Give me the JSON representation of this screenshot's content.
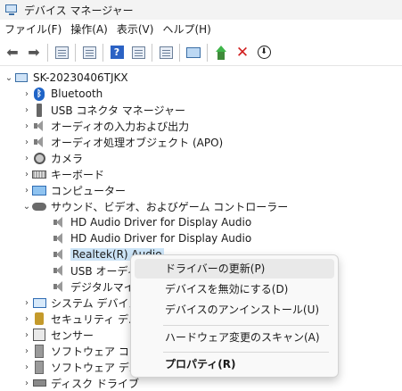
{
  "window": {
    "title": "デバイス マネージャー"
  },
  "menu": [
    "ファイル(F)",
    "操作(A)",
    "表示(V)",
    "ヘルプ(H)"
  ],
  "toolbar": {
    "back_icon": "back-arrow",
    "forward_icon": "forward-arrow",
    "help_glyph": "?",
    "remove_glyph": "✕",
    "update_glyph": "⬇"
  },
  "tree": {
    "root": "SK-20230406TJKX",
    "categories": [
      {
        "label": "Bluetooth",
        "icon": "bluetooth-icon"
      },
      {
        "label": "USB コネクタ マネージャー",
        "icon": "usb-icon"
      },
      {
        "label": "オーディオの入力および出力",
        "icon": "speaker-icon"
      },
      {
        "label": "オーディオ処理オブジェクト (APO)",
        "icon": "speaker-icon"
      },
      {
        "label": "カメラ",
        "icon": "camera-icon"
      },
      {
        "label": "キーボード",
        "icon": "keyboard-icon"
      },
      {
        "label": "コンピューター",
        "icon": "monitor-icon"
      },
      {
        "label": "サウンド、ビデオ、およびゲーム コントローラー",
        "icon": "gamepad-icon"
      }
    ],
    "sound_children": [
      "HD Audio Driver for Display Audio",
      "HD Audio Driver for Display Audio",
      "Realtek(R) Audio",
      "USB オーディオ",
      "デジタルマイク"
    ],
    "more_categories": [
      {
        "label": "システム デバイス",
        "icon": "system-icon"
      },
      {
        "label": "セキュリティ デバイス",
        "icon": "security-icon"
      },
      {
        "label": "センサー",
        "icon": "sensor-icon"
      },
      {
        "label": "ソフトウェア コンポー",
        "icon": "software-icon"
      },
      {
        "label": "ソフトウェア デバイス",
        "icon": "software-icon"
      },
      {
        "label": "ディスク ドライブ",
        "icon": "disk-icon"
      }
    ]
  },
  "context_menu": {
    "update_driver": "ドライバーの更新(P)",
    "disable_device": "デバイスを無効にする(D)",
    "uninstall_device": "デバイスのアンインストール(U)",
    "scan_changes": "ハードウェア変更のスキャン(A)",
    "properties": "プロパティ(R)"
  }
}
